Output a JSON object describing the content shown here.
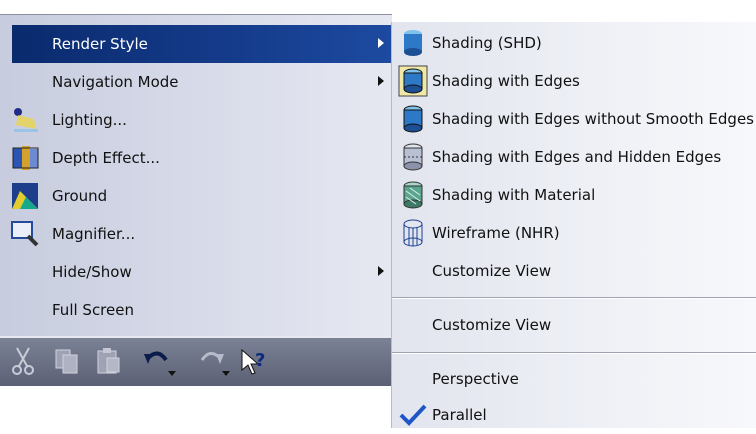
{
  "left_menu": {
    "items": [
      {
        "label": "Render Style",
        "icon": "",
        "submenu": true,
        "highlighted": true
      },
      {
        "label": "Navigation Mode",
        "icon": "",
        "submenu": true
      },
      {
        "label": "Lighting...",
        "icon": "lighting-icon",
        "submenu": false
      },
      {
        "label": "Depth Effect...",
        "icon": "depth-effect-icon",
        "submenu": false
      },
      {
        "label": "Ground",
        "icon": "ground-icon",
        "submenu": false
      },
      {
        "label": "Magnifier...",
        "icon": "magnifier-icon",
        "submenu": false
      },
      {
        "label": "Hide/Show",
        "icon": "",
        "submenu": true
      },
      {
        "label": "Full Screen",
        "icon": "",
        "submenu": false
      }
    ]
  },
  "toolbar": {
    "buttons": [
      "cut-icon",
      "copy-icon",
      "paste-icon",
      "undo-icon",
      "redo-icon",
      "whats-this-icon"
    ]
  },
  "submenu": {
    "items": [
      {
        "label": "Shading (SHD)",
        "icon": "shading-icon"
      },
      {
        "label": "Shading with Edges",
        "icon": "shading-edges-icon",
        "selected": true
      },
      {
        "label": "Shading with Edges without Smooth Edges",
        "icon": "shading-edges-no-smooth-icon"
      },
      {
        "label": "Shading with Edges and Hidden Edges",
        "icon": "shading-hidden-edges-icon"
      },
      {
        "label": "Shading with Material",
        "icon": "shading-material-icon"
      },
      {
        "label": "Wireframe (NHR)",
        "icon": "wireframe-icon"
      },
      {
        "label": "Customize View",
        "icon": ""
      }
    ],
    "customize_view_label": "Customize View",
    "perspective_label": "Perspective",
    "parallel_label": "Parallel",
    "parallel_checked": true
  },
  "colors": {
    "highlight": "#153c8c",
    "menu_bg": "#d5d9e8",
    "submenu_bg": "#eef0f6",
    "toolbar_bg": "#6c7186"
  }
}
